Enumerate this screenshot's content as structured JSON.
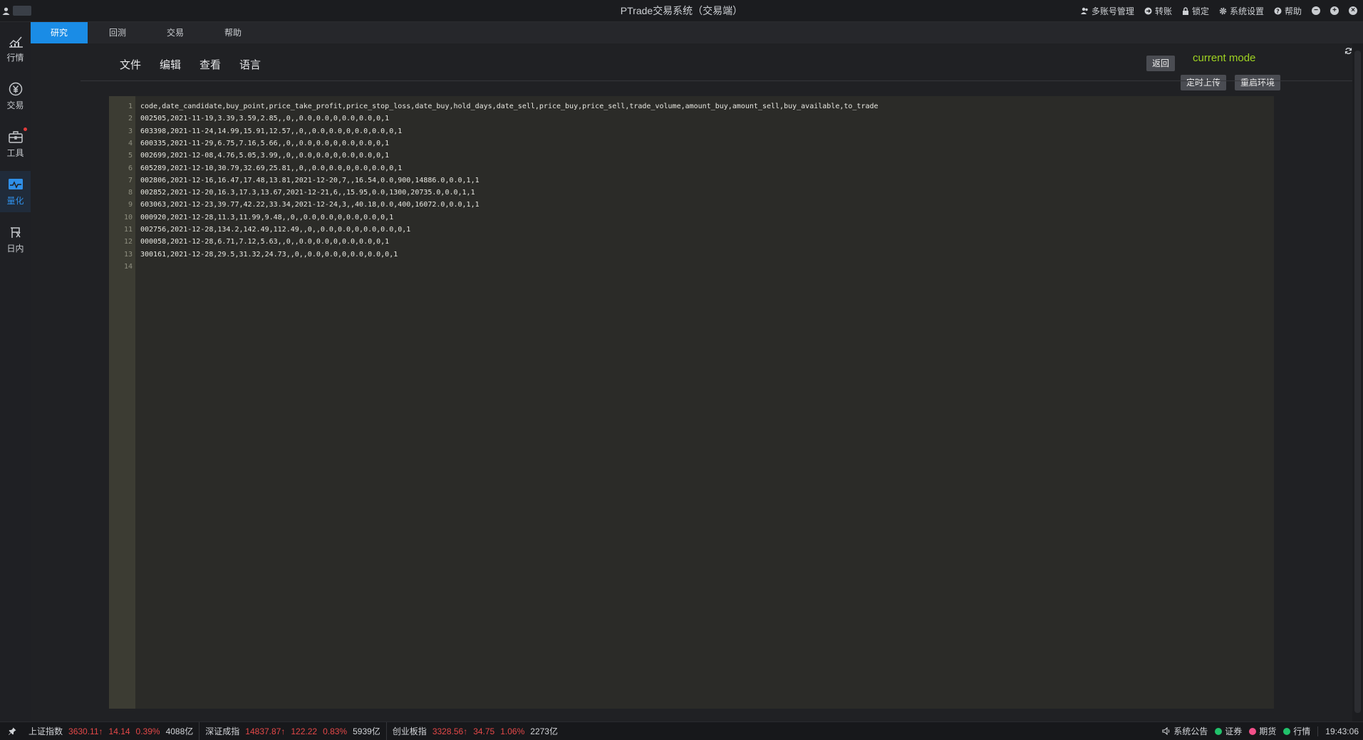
{
  "window": {
    "title": "PTrade交易系统（交易端）",
    "actions": [
      {
        "icon": "accounts-icon",
        "label": "多账号管理"
      },
      {
        "icon": "transfer-icon",
        "label": "转账"
      },
      {
        "icon": "lock-icon",
        "label": "锁定"
      },
      {
        "icon": "gear-icon",
        "label": "系统设置"
      },
      {
        "icon": "help-icon",
        "label": "帮助"
      }
    ]
  },
  "sidebar": {
    "items": [
      {
        "icon": "chart-icon",
        "label": "行情"
      },
      {
        "icon": "yen-icon",
        "label": "交易"
      },
      {
        "icon": "toolbox-icon",
        "label": "工具"
      },
      {
        "icon": "quant-icon",
        "label": "量化"
      },
      {
        "icon": "intraday-icon",
        "label": "日内"
      }
    ],
    "active": "量化"
  },
  "tabs": [
    {
      "label": "研究"
    },
    {
      "label": "回测"
    },
    {
      "label": "交易"
    },
    {
      "label": "帮助"
    }
  ],
  "active_tab": "研究",
  "menu": [
    "文件",
    "编辑",
    "查看",
    "语言"
  ],
  "buttons": {
    "back": "返回",
    "scheduled_upload": "定时上传",
    "restart_env": "重启环境"
  },
  "mode_label": "current mode",
  "editor": {
    "lines": [
      {
        "no": "1",
        "text": "code,date_candidate,buy_point,price_take_profit,price_stop_loss,date_buy,hold_days,date_sell,price_buy,price_sell,trade_volume,amount_buy,amount_sell,buy_available,to_trade"
      },
      {
        "no": "2",
        "text": "002505,2021-11-19,3.39,3.59,2.85,,0,,0.0,0.0,0,0.0,0.0,0,1"
      },
      {
        "no": "3",
        "text": "603398,2021-11-24,14.99,15.91,12.57,,0,,0.0,0.0,0,0.0,0.0,0,1"
      },
      {
        "no": "4",
        "text": "600335,2021-11-29,6.75,7.16,5.66,,0,,0.0,0.0,0,0.0,0.0,0,1"
      },
      {
        "no": "5",
        "text": "002699,2021-12-08,4.76,5.05,3.99,,0,,0.0,0.0,0,0.0,0.0,0,1"
      },
      {
        "no": "6",
        "text": "605289,2021-12-10,30.79,32.69,25.81,,0,,0.0,0.0,0,0.0,0.0,0,1"
      },
      {
        "no": "7",
        "text": "002806,2021-12-16,16.47,17.48,13.81,2021-12-20,7,,16.54,0.0,900,14886.0,0.0,1,1"
      },
      {
        "no": "8",
        "text": "002852,2021-12-20,16.3,17.3,13.67,2021-12-21,6,,15.95,0.0,1300,20735.0,0.0,1,1"
      },
      {
        "no": "9",
        "text": "603063,2021-12-23,39.77,42.22,33.34,2021-12-24,3,,40.18,0.0,400,16072.0,0.0,1,1"
      },
      {
        "no": "10",
        "text": "000920,2021-12-28,11.3,11.99,9.48,,0,,0.0,0.0,0,0.0,0.0,0,1"
      },
      {
        "no": "11",
        "text": "002756,2021-12-28,134.2,142.49,112.49,,0,,0.0,0.0,0,0.0,0.0,0,1"
      },
      {
        "no": "12",
        "text": "000058,2021-12-28,6.71,7.12,5.63,,0,,0.0,0.0,0,0.0,0.0,0,1"
      },
      {
        "no": "13",
        "text": "300161,2021-12-28,29.5,31.32,24.73,,0,,0.0,0.0,0,0.0,0.0,0,1"
      },
      {
        "no": "14",
        "text": ""
      }
    ]
  },
  "status": {
    "indices": [
      {
        "name": "上证指数",
        "value": "3630.11↑",
        "change": "14.14",
        "pct": "0.39%",
        "volume": "4088亿"
      },
      {
        "name": "深证成指",
        "value": "14837.87↑",
        "change": "122.22",
        "pct": "0.83%",
        "volume": "5939亿"
      },
      {
        "name": "创业板指",
        "value": "3328.56↑",
        "change": "34.75",
        "pct": "1.06%",
        "volume": "2273亿"
      }
    ],
    "announcement": "系统公告",
    "connections": [
      {
        "label": "证券",
        "color": "#21c26b"
      },
      {
        "label": "期货",
        "color": "#f2508a"
      },
      {
        "label": "行情",
        "color": "#21c26b"
      }
    ],
    "time": "19:43:06"
  },
  "colors": {
    "accent": "#1a8ce6",
    "mode_label": "#9fd321",
    "index_up": "#e54848"
  }
}
